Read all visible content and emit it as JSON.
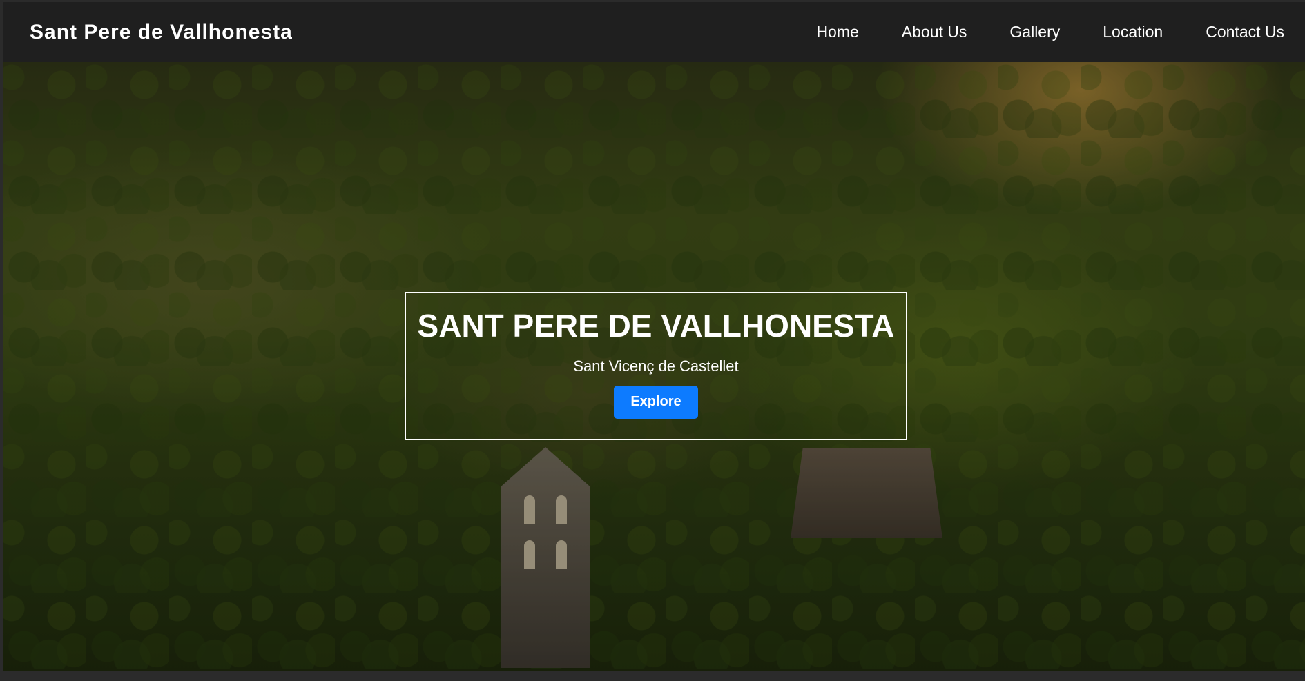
{
  "navbar": {
    "brand": "Sant Pere de Vallhonesta",
    "links": [
      "Home",
      "About Us",
      "Gallery",
      "Location",
      "Contact Us"
    ]
  },
  "hero": {
    "title": "SANT PERE DE VALLHONESTA",
    "subtitle": "Sant Vicenç de Castellet",
    "button_label": "Explore",
    "background_description": "aerial forest landscape with Romanesque church bell gable"
  },
  "colors": {
    "navbar_bg": "#1f1f1f",
    "button_bg": "#0d7bff",
    "text": "#ffffff"
  }
}
